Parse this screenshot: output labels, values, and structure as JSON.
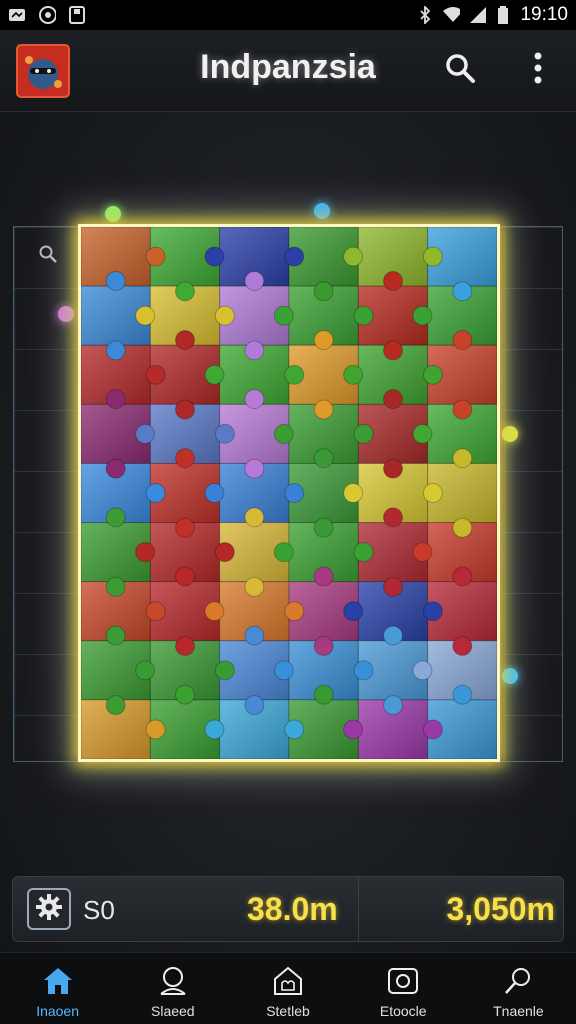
{
  "status_bar": {
    "time": "19:10",
    "left_icons": [
      "notification-icon",
      "sync-icon",
      "sd-card-icon"
    ],
    "right_icons": [
      "bluetooth-icon",
      "wifi-icon",
      "signal-icon",
      "battery-icon"
    ]
  },
  "app_bar": {
    "title": "Indpanzsia",
    "logo_icon": "app-logo-icon",
    "search_icon": "search-icon",
    "menu_icon": "more-vert-icon"
  },
  "puzzle": {
    "columns": 6,
    "rows": 9,
    "tiles": [
      [
        "#c8622a",
        "#3faa34",
        "#2b3fa8",
        "#3a9a30",
        "#8fb82c",
        "#3aa0e0"
      ],
      [
        "#3a8ad8",
        "#d8c030",
        "#b07ad8",
        "#3aa232",
        "#b82a20",
        "#3aa234"
      ],
      [
        "#b52a2a",
        "#b02828",
        "#3fa832",
        "#e09a2a",
        "#3fa430",
        "#c8422a"
      ],
      [
        "#8a2a70",
        "#5a7ac8",
        "#b87ad8",
        "#3a9e32",
        "#a82828",
        "#3ea832"
      ],
      [
        "#3a8ae0",
        "#c03028",
        "#3a80d8",
        "#3a9a38",
        "#d8c834",
        "#c8b82c"
      ],
      [
        "#3a9c32",
        "#b52828",
        "#d8b838",
        "#3aa232",
        "#b02832",
        "#c83a2a"
      ],
      [
        "#c8482a",
        "#b8282a",
        "#d87a2a",
        "#a83a80",
        "#2840a8",
        "#b82838"
      ],
      [
        "#3a9c32",
        "#3a9a34",
        "#4a88d8",
        "#3a90d8",
        "#4a9ad8",
        "#8aa8d8"
      ],
      [
        "#d89a2a",
        "#3aa030",
        "#3aa8d8",
        "#3a9a32",
        "#9a38a8",
        "#3a98d8"
      ]
    ],
    "colors": {
      "board_border": "#fff8c0",
      "glow_yellow": "#ffd23c",
      "glow_green": "#50ff78",
      "glow_pink": "#ff50c8"
    }
  },
  "score_bar": {
    "settings_icon": "gear-icon",
    "left_label": "S0",
    "mid_value": "38.0m",
    "right_value": "3,050m",
    "value_color": "#f7e04a"
  },
  "bottom_nav": {
    "items": [
      {
        "label": "Inaoen",
        "icon": "home-icon",
        "active": true
      },
      {
        "label": "Slaeed",
        "icon": "profile-icon",
        "active": false
      },
      {
        "label": "Stetleb",
        "icon": "puzzle-house-icon",
        "active": false
      },
      {
        "label": "Etoocle",
        "icon": "camera-icon",
        "active": false
      },
      {
        "label": "Tnaenle",
        "icon": "search-icon",
        "active": false
      }
    ],
    "active_color": "#56b6ff"
  }
}
